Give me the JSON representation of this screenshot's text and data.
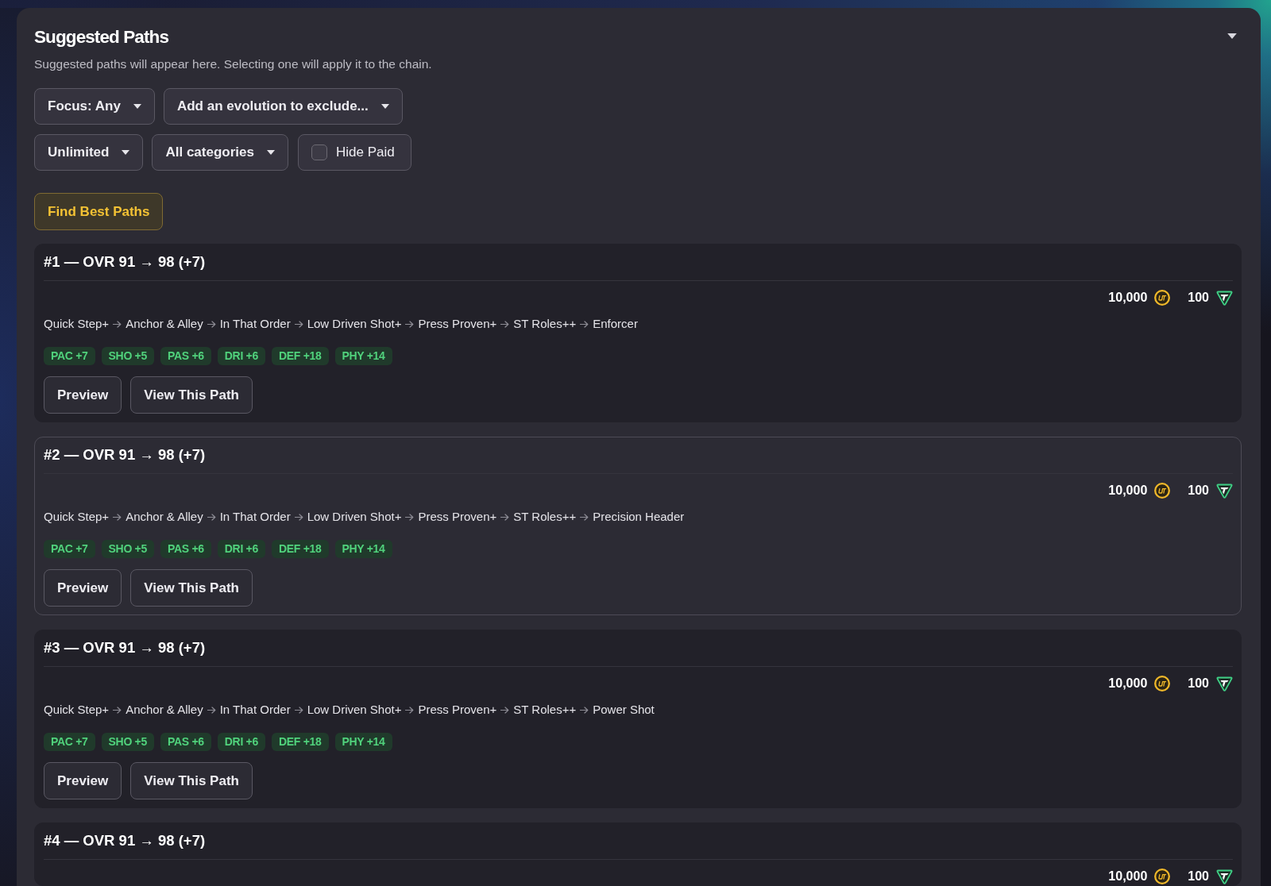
{
  "panel": {
    "title": "Suggested Paths",
    "subtitle": "Suggested paths will appear here. Selecting one will apply it to the chain.",
    "expanded": true
  },
  "filter_rows": [
    {
      "items": [
        {
          "kind": "dropdown",
          "label": "Focus: Any"
        },
        {
          "kind": "dropdown",
          "label": "Add an evolution to exclude..."
        }
      ]
    },
    {
      "items": [
        {
          "kind": "dropdown",
          "label": "Unlimited"
        },
        {
          "kind": "dropdown",
          "label": "All categories"
        },
        {
          "kind": "checkbox",
          "label": "Hide Paid",
          "checked": false
        }
      ]
    }
  ],
  "find_button": {
    "label": "Find Best Paths"
  },
  "paths": [
    {
      "title": "#1 — OVR 91 → 98 (+7)",
      "selected": false,
      "cost": {
        "coins": "10,000",
        "points": "100"
      },
      "steps": [
        "Quick Step+",
        "Anchor & Alley",
        "In That Order",
        "Low Driven Shot+",
        "Press Proven+",
        "ST Roles++",
        "Enforcer"
      ],
      "stats": [
        "PAC +7",
        "SHO +5",
        "PAS +6",
        "DRI +6",
        "DEF +18",
        "PHY +14"
      ],
      "actions": [
        "Preview",
        "View This Path"
      ]
    },
    {
      "title": "#2 — OVR 91 → 98 (+7)",
      "selected": true,
      "cost": {
        "coins": "10,000",
        "points": "100"
      },
      "steps": [
        "Quick Step+",
        "Anchor & Alley",
        "In That Order",
        "Low Driven Shot+",
        "Press Proven+",
        "ST Roles++",
        "Precision Header"
      ],
      "stats": [
        "PAC +7",
        "SHO +5",
        "PAS +6",
        "DRI +6",
        "DEF +18",
        "PHY +14"
      ],
      "actions": [
        "Preview",
        "View This Path"
      ]
    },
    {
      "title": "#3 — OVR 91 → 98 (+7)",
      "selected": false,
      "cost": {
        "coins": "10,000",
        "points": "100"
      },
      "steps": [
        "Quick Step+",
        "Anchor & Alley",
        "In That Order",
        "Low Driven Shot+",
        "Press Proven+",
        "ST Roles++",
        "Power Shot"
      ],
      "stats": [
        "PAC +7",
        "SHO +5",
        "PAS +6",
        "DRI +6",
        "DEF +18",
        "PHY +14"
      ],
      "actions": [
        "Preview",
        "View This Path"
      ]
    },
    {
      "title": "#4 — OVR 91 → 98 (+7)",
      "selected": false,
      "cost": {
        "coins": "10,000",
        "points": "100"
      }
    }
  ]
}
